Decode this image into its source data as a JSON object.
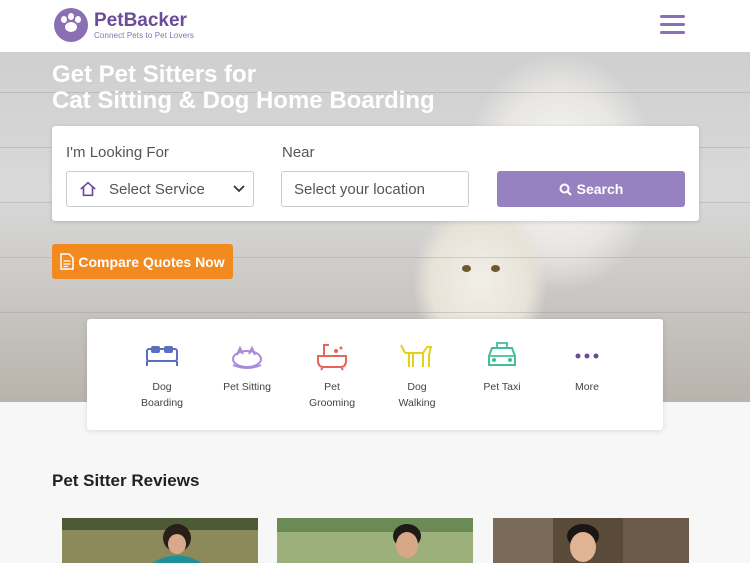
{
  "header": {
    "brand": "PetBacker",
    "tagline": "Connect Pets to Pet Lovers"
  },
  "hero": {
    "title_line1": "Get Pet Sitters for",
    "title_line2": "Cat Sitting & Dog Home Boarding"
  },
  "search": {
    "looking_for_label": "I'm Looking For",
    "near_label": "Near",
    "service_select_value": "Select Service",
    "location_placeholder": "Select your location",
    "search_button": "Search"
  },
  "compare_button": "Compare Quotes Now",
  "services": [
    {
      "label": "Dog\nBoarding",
      "icon": "bed-icon",
      "color": "#5a6fc0"
    },
    {
      "label": "Pet Sitting",
      "icon": "sleeping-pet-icon",
      "color": "#a98bd6"
    },
    {
      "label": "Pet\nGrooming",
      "icon": "bathtub-icon",
      "color": "#e8635a"
    },
    {
      "label": "Dog\nWalking",
      "icon": "dog-walking-icon",
      "color": "#e3d21a"
    },
    {
      "label": "Pet Taxi",
      "icon": "taxi-icon",
      "color": "#3fbf9a"
    },
    {
      "label": "More",
      "icon": "more-dots-icon",
      "color": "#6b4c9a"
    }
  ],
  "reviews": {
    "title": "Pet Sitter Reviews"
  },
  "colors": {
    "brand_purple": "#6b4c9a",
    "search_button": "#9682c0",
    "compare_button": "#f28a1f"
  }
}
